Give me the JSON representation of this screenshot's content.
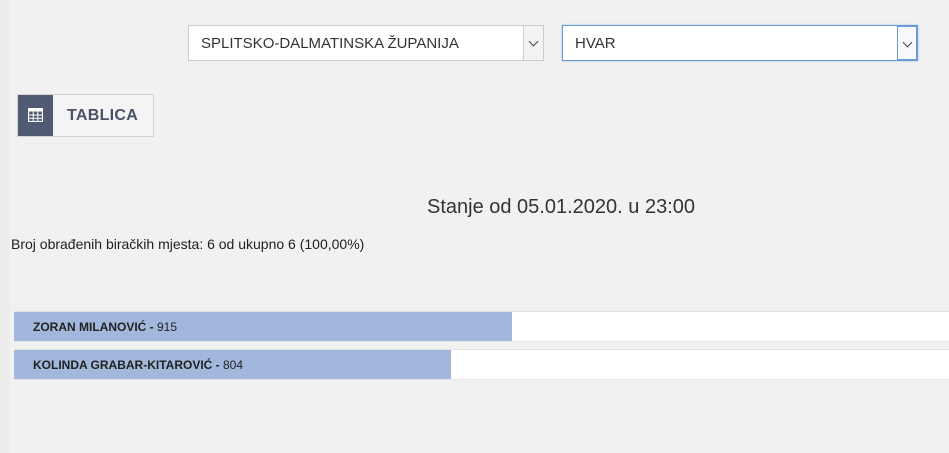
{
  "filters": {
    "county": "SPLITSKO-DALMATINSKA ŽUPANIJA",
    "municipality": "HVAR"
  },
  "view_button": {
    "label": "TABLICA",
    "icon": "table-icon"
  },
  "status": {
    "title": "Stanje od 05.01.2020. u 23:00",
    "processed": "Broj obrađenih biračkih mjesta: 6 od ukupno 6 (100,00%)"
  },
  "chart_data": {
    "type": "bar",
    "categories": [
      "ZORAN MILANOVIĆ",
      "KOLINDA GRABAR-KITAROVIĆ"
    ],
    "values": [
      915,
      804
    ],
    "value_labels": [
      "915",
      "804"
    ],
    "separator": " - ",
    "max": 1719
  },
  "colors": {
    "bar": "#a1b8dc",
    "button_icon_bg": "#505a73"
  }
}
